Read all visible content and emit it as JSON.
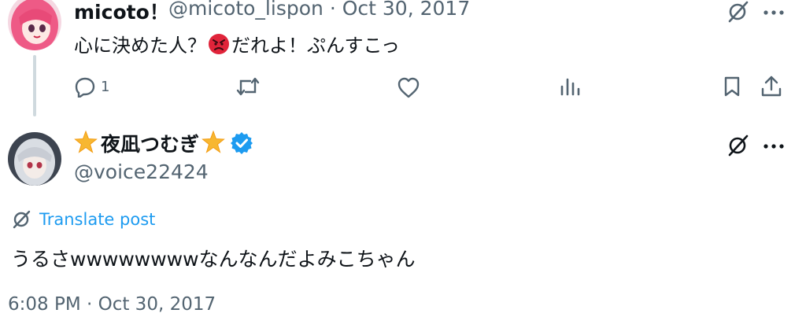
{
  "tweet1": {
    "display_name": "micoto！",
    "handle": "@micoto_lispon",
    "separator": "·",
    "date": "Oct 30, 2017",
    "text_before_emoji": "心に決めた人？",
    "emoji": "angry-face",
    "text_after_emoji": "だれよ！ぷんすこっ",
    "reply_count": "1",
    "accent_color": "#f0557a"
  },
  "tweet2": {
    "display_name": "夜凪つむぎ",
    "verified": true,
    "handle": "@voice22424",
    "translate_label": "Translate post",
    "text": "うるさwwwwwwwwなんなんだよみこちゃん",
    "timestamp": "6:08 PM · Oct 30, 2017",
    "verified_color": "#1d9bf0",
    "star_color": "#f7b731"
  },
  "icons": {
    "grok": "grok-icon",
    "more": "more-icon",
    "reply": "reply-icon",
    "retweet": "retweet-icon",
    "like": "heart-icon",
    "views": "views-icon",
    "bookmark": "bookmark-icon",
    "share": "share-icon"
  },
  "colors": {
    "text_primary": "#0f1419",
    "text_secondary": "#536471",
    "link": "#1d9bf0",
    "thread_line": "#cfd9de"
  }
}
